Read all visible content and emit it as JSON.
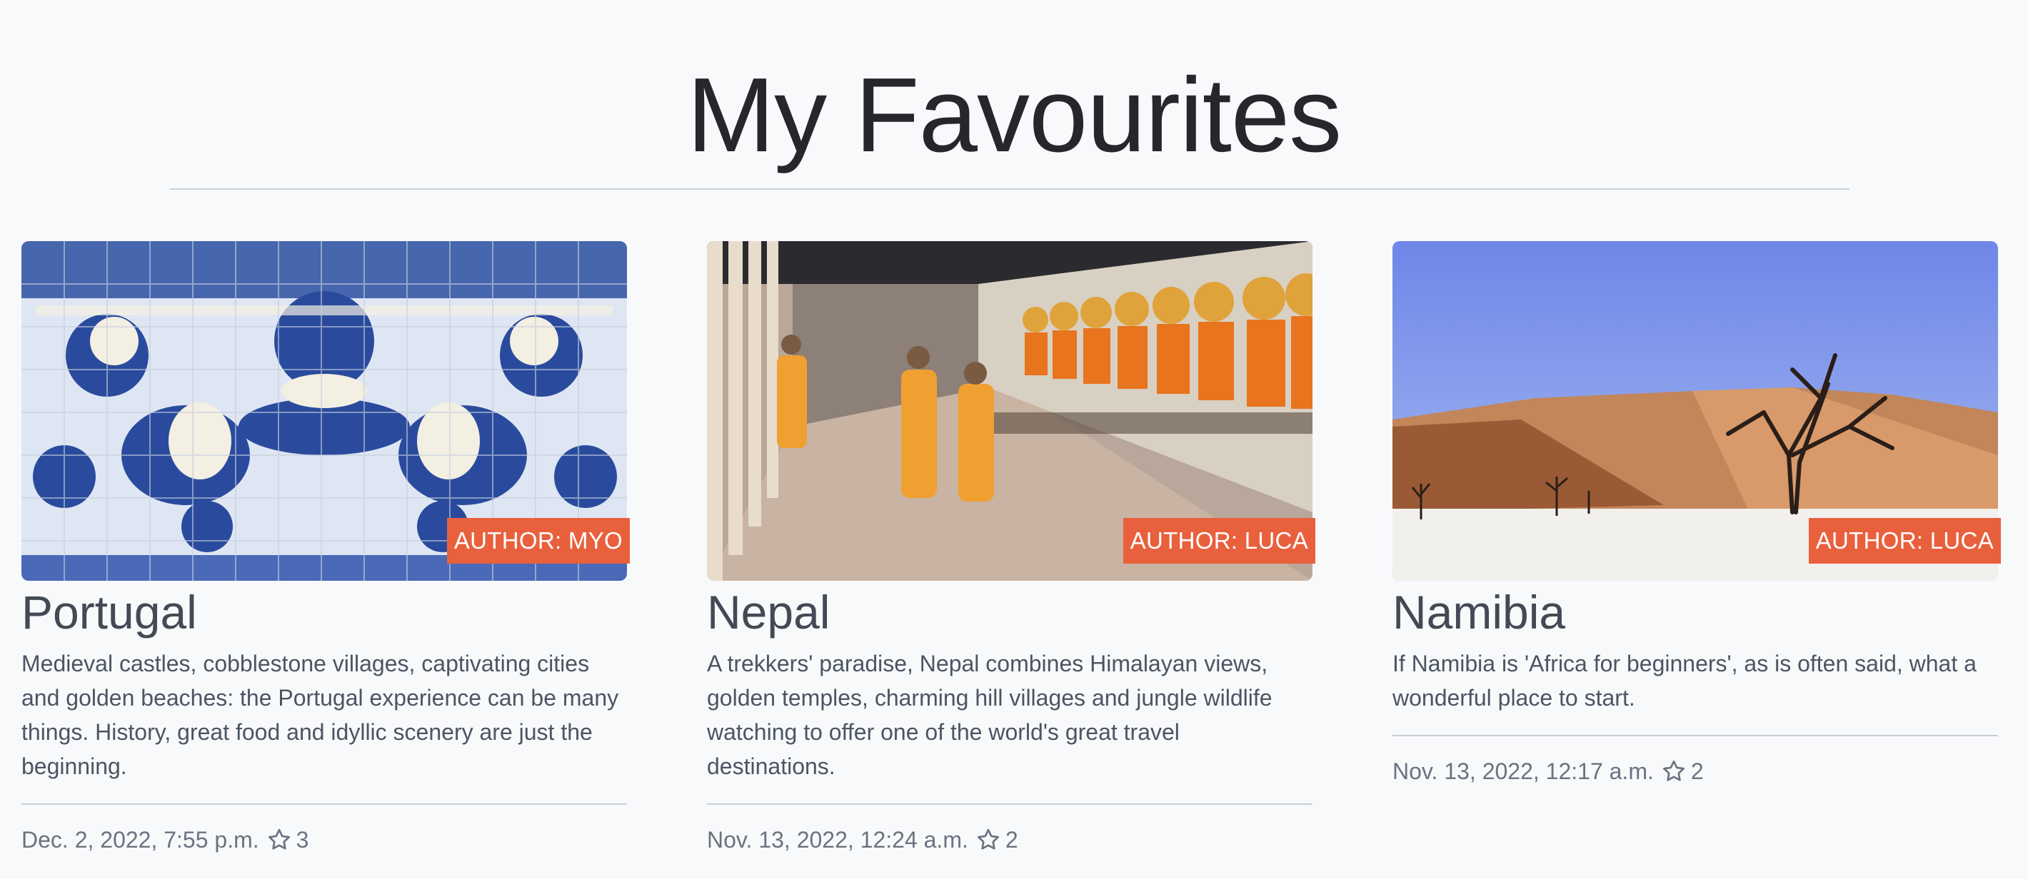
{
  "page": {
    "title": "My Favourites"
  },
  "cards": [
    {
      "title": "Portugal",
      "author_label": "AUTHOR: MYO",
      "description": "Medieval castles, cobblestone villages, captivating cities and golden beaches: the Portugal experience can be many things. History, great food and idyllic scenery are just the beginning.",
      "date": "Dec. 2, 2022, 7:55 p.m.",
      "likes": "3",
      "image_alt": "blue-azulejo-tiles"
    },
    {
      "title": "Nepal",
      "author_label": "AUTHOR: LUCA",
      "description": "A trekkers' paradise, Nepal combines Himalayan views, golden temples, charming hill villages and jungle wildlife watching to offer one of the world's great travel destinations.",
      "date": "Nov. 13, 2022, 12:24 a.m.",
      "likes": "2",
      "image_alt": "monks-temple-buddhas"
    },
    {
      "title": "Namibia",
      "author_label": "AUTHOR: LUCA",
      "description": "If Namibia is 'Africa for beginners', as is often said, what a wonderful place to start.",
      "date": "Nov. 13, 2022, 12:17 a.m.",
      "likes": "2",
      "image_alt": "desert-dead-tree"
    }
  ],
  "icons": {
    "like": "star-icon"
  },
  "colors": {
    "accent": "#e9603d",
    "background": "#f8f9fb",
    "title": "#25272b",
    "text": "#4b5563",
    "divider": "#c9cdd3"
  }
}
